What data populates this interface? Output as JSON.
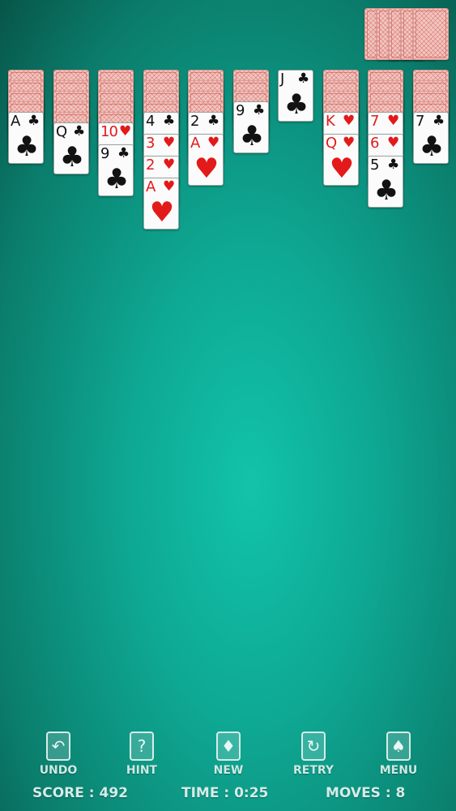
{
  "stock": {
    "count": 5
  },
  "tableau": [
    {
      "facedown": 4,
      "faceup": [
        {
          "rank": "A",
          "suit": "♣",
          "color": "black"
        }
      ]
    },
    {
      "facedown": 5,
      "faceup": [
        {
          "rank": "Q",
          "suit": "♣",
          "color": "black"
        }
      ]
    },
    {
      "facedown": 5,
      "faceup": [
        {
          "rank": "10",
          "suit": "♥",
          "color": "red"
        },
        {
          "rank": "9",
          "suit": "♣",
          "color": "black"
        }
      ]
    },
    {
      "facedown": 4,
      "faceup": [
        {
          "rank": "4",
          "suit": "♣",
          "color": "black"
        },
        {
          "rank": "3",
          "suit": "♥",
          "color": "red"
        },
        {
          "rank": "2",
          "suit": "♥",
          "color": "red"
        },
        {
          "rank": "A",
          "suit": "♥",
          "color": "red"
        }
      ]
    },
    {
      "facedown": 4,
      "faceup": [
        {
          "rank": "2",
          "suit": "♣",
          "color": "black"
        },
        {
          "rank": "A",
          "suit": "♥",
          "color": "red"
        }
      ]
    },
    {
      "facedown": 3,
      "faceup": [
        {
          "rank": "9",
          "suit": "♣",
          "color": "black"
        }
      ]
    },
    {
      "facedown": 0,
      "faceup": [
        {
          "rank": "J",
          "suit": "♣",
          "color": "black"
        }
      ]
    },
    {
      "facedown": 4,
      "faceup": [
        {
          "rank": "K",
          "suit": "♥",
          "color": "red"
        },
        {
          "rank": "Q",
          "suit": "♥",
          "color": "red"
        }
      ]
    },
    {
      "facedown": 4,
      "faceup": [
        {
          "rank": "7",
          "suit": "♥",
          "color": "red"
        },
        {
          "rank": "6",
          "suit": "♥",
          "color": "red"
        },
        {
          "rank": "5",
          "suit": "♣",
          "color": "black"
        }
      ]
    },
    {
      "facedown": 4,
      "faceup": [
        {
          "rank": "7",
          "suit": "♣",
          "color": "black"
        }
      ]
    }
  ],
  "toolbar": {
    "undo": {
      "label": "UNDO",
      "icon": "undo-arrow-icon"
    },
    "hint": {
      "label": "HINT",
      "icon": "hint-card-icon"
    },
    "new": {
      "label": "NEW",
      "icon": "new-cards-icon"
    },
    "retry": {
      "label": "RETRY",
      "icon": "retry-arrow-icon"
    },
    "menu": {
      "label": "MENU",
      "icon": "menu-cards-icon"
    }
  },
  "status": {
    "score": "SCORE : 492",
    "time": "TIME : 0:25",
    "moves": "MOVES : 8"
  },
  "colors": {
    "felt_center": "#12c3aa",
    "felt_edge": "#075548",
    "red_suit": "#e21a1a",
    "black_suit": "#121212"
  }
}
